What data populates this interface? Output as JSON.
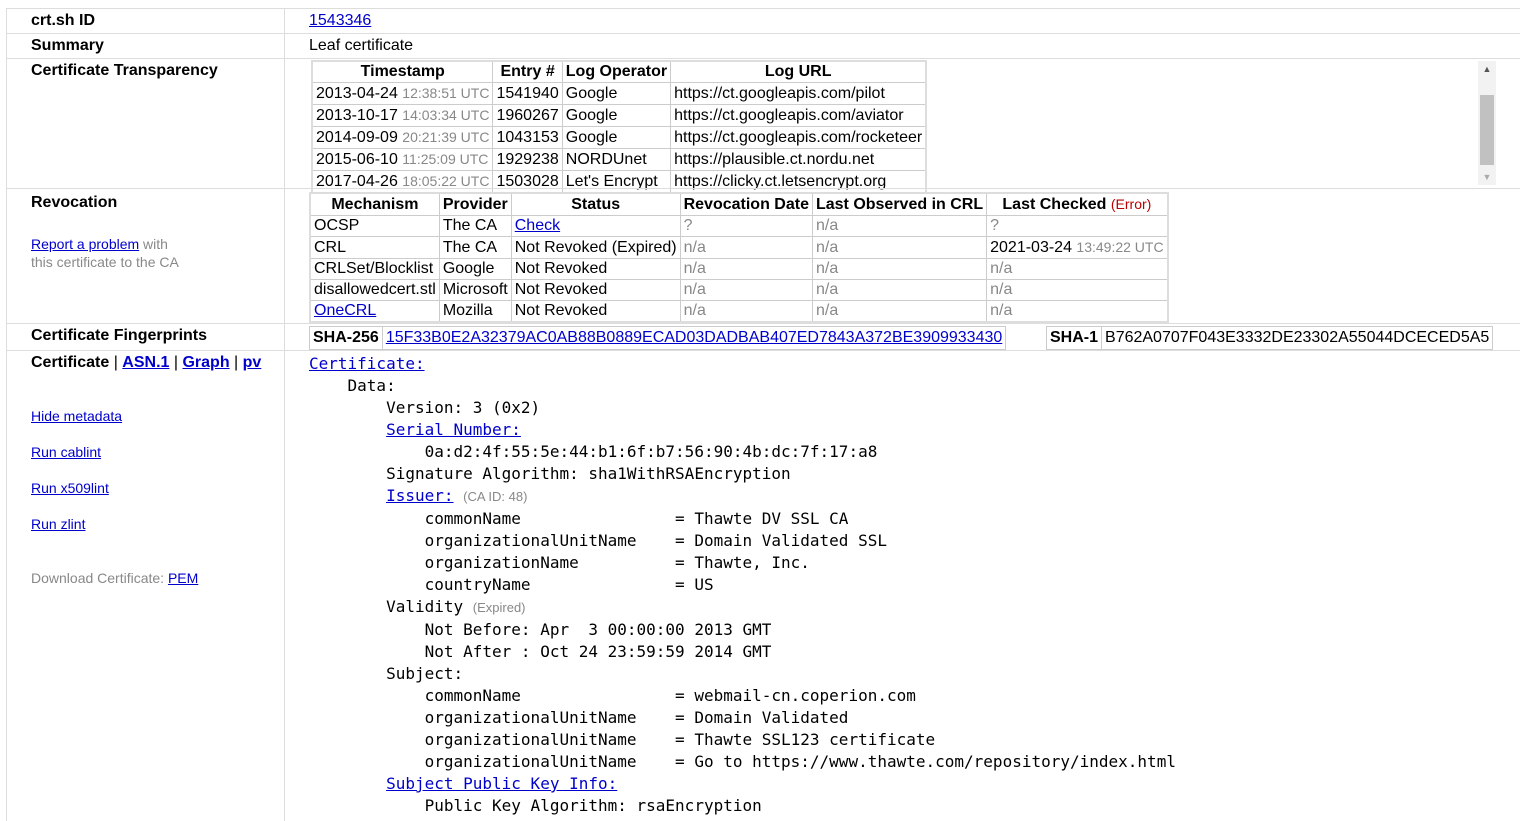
{
  "rows": {
    "id": {
      "label": "crt.sh ID",
      "value": "1543346"
    },
    "summary": {
      "label": "Summary",
      "value": "Leaf certificate"
    },
    "ct": {
      "label": "Certificate Transparency",
      "headers": [
        "Timestamp",
        "Entry #",
        "Log Operator",
        "Log URL"
      ],
      "entries": [
        {
          "date": "2013-04-24",
          "time": "12:38:51 UTC",
          "entry": "1541940",
          "operator": "Google",
          "url": "https://ct.googleapis.com/pilot"
        },
        {
          "date": "2013-10-17",
          "time": "14:03:34 UTC",
          "entry": "1960267",
          "operator": "Google",
          "url": "https://ct.googleapis.com/aviator"
        },
        {
          "date": "2014-09-09",
          "time": "20:21:39 UTC",
          "entry": "1043153",
          "operator": "Google",
          "url": "https://ct.googleapis.com/rocketeer"
        },
        {
          "date": "2015-06-10",
          "time": "11:25:09 UTC",
          "entry": "1929238",
          "operator": "NORDUnet",
          "url": "https://plausible.ct.nordu.net"
        },
        {
          "date": "2017-04-26",
          "time": "18:05:22 UTC",
          "entry": "1503028",
          "operator": "Let's Encrypt",
          "url": "https://clicky.ct.letsencrypt.org"
        }
      ]
    },
    "revocation": {
      "label": "Revocation",
      "report_link": "Report a problem",
      "report_text_1": " with",
      "report_text_2": "this certificate to the CA",
      "headers": [
        "Mechanism",
        "Provider",
        "Status",
        "Revocation Date",
        "Last Observed in CRL",
        "Last Checked"
      ],
      "last_checked_note": "(Error)",
      "entries": [
        {
          "mechanism": "OCSP",
          "provider": "The CA",
          "status": "Check",
          "rev_date": "?",
          "last_observed": "n/a",
          "checked_date": "?",
          "checked_time": ""
        },
        {
          "mechanism": "CRL",
          "provider": "The CA",
          "status": "Not Revoked (Expired)",
          "rev_date": "n/a",
          "last_observed": "n/a",
          "checked_date": "2021-03-24",
          "checked_time": "13:49:22 UTC"
        },
        {
          "mechanism": "CRLSet/Blocklist",
          "provider": "Google",
          "status": "Not Revoked",
          "rev_date": "n/a",
          "last_observed": "n/a",
          "checked_date": "n/a",
          "checked_time": ""
        },
        {
          "mechanism": "disallowedcert.stl",
          "provider": "Microsoft",
          "status": "Not Revoked",
          "rev_date": "n/a",
          "last_observed": "n/a",
          "checked_date": "n/a",
          "checked_time": ""
        },
        {
          "mechanism": "OneCRL",
          "provider": "Mozilla",
          "status": "Not Revoked",
          "rev_date": "n/a",
          "last_observed": "n/a",
          "checked_date": "n/a",
          "checked_time": ""
        }
      ]
    },
    "fingerprints": {
      "label": "Certificate Fingerprints",
      "sha256_label": "SHA-256",
      "sha256": "15F33B0E2A32379AC0AB88B0889ECAD03DADBAB407ED7843A372BE3909933430",
      "sha1_label": "SHA-1",
      "sha1": "B762A0707F043E3332DE23302A55044DCECED5A5"
    },
    "certificate": {
      "label": "Certificate",
      "sep": " | ",
      "links": [
        "ASN.1",
        "Graph",
        "pv"
      ],
      "hide_metadata": "Hide metadata",
      "run_cablint": "Run cablint",
      "run_x509lint": "Run x509lint",
      "run_zlint": "Run zlint",
      "download_label": "Download Certificate: ",
      "download_pem": "PEM"
    }
  },
  "cert_text": {
    "certificate": "Certificate:",
    "data": "Data:",
    "version": "Version: 3 (0x2)",
    "serial_label": "Serial Number:",
    "serial": "0a:d2:4f:55:5e:44:b1:6f:b7:56:90:4b:dc:7f:17:a8",
    "sig_alg": "Signature Algorithm: sha1WithRSAEncryption",
    "issuer_label": "Issuer:",
    "issuer_note": "(CA ID: 48)",
    "issuer": [
      "commonName                = Thawte DV SSL CA",
      "organizationalUnitName    = Domain Validated SSL",
      "organizationName          = Thawte, Inc.",
      "countryName               = US"
    ],
    "validity_label": "Validity",
    "validity_note": "(Expired)",
    "not_before": "Not Before: Apr  3 00:00:00 2013 GMT",
    "not_after": "Not After : Oct 24 23:59:59 2014 GMT",
    "subject_label": "Subject:",
    "subject": [
      "commonName                = webmail-cn.coperion.com",
      "organizationalUnitName    = Domain Validated",
      "organizationalUnitName    = Thawte SSL123 certificate",
      "organizationalUnitName    = Go to https://www.thawte.com/repository/index.html"
    ],
    "spki_label": "Subject Public Key Info:",
    "pk_alg": "Public Key Algorithm: rsaEncryption"
  }
}
